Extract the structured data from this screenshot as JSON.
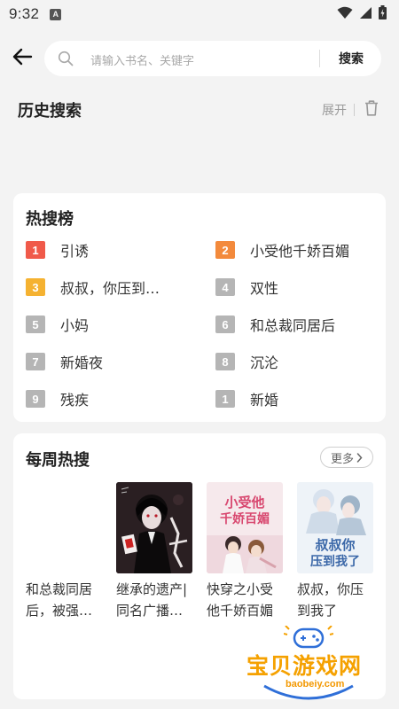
{
  "status_bar": {
    "time": "9:32",
    "notification_badge": "A"
  },
  "search": {
    "placeholder": "请输入书名、关键字",
    "button_label": "搜索"
  },
  "history": {
    "title": "历史搜索",
    "expand_label": "展开"
  },
  "hot_list": {
    "title": "热搜榜",
    "rank_colors": {
      "1": "#f05a4a",
      "2": "#f38a3c",
      "3": "#f5b231",
      "other": "#b5b5b5"
    },
    "items": [
      {
        "rank": "1",
        "title": "引诱"
      },
      {
        "rank": "2",
        "title": "小受他千娇百媚"
      },
      {
        "rank": "3",
        "title": "叔叔，你压到…"
      },
      {
        "rank": "4",
        "title": "双性"
      },
      {
        "rank": "5",
        "title": "小妈"
      },
      {
        "rank": "6",
        "title": "和总裁同居后"
      },
      {
        "rank": "7",
        "title": "新婚夜"
      },
      {
        "rank": "8",
        "title": "沉沦"
      },
      {
        "rank": "9",
        "title": "残疾"
      },
      {
        "rank": "1",
        "title": "新婚"
      }
    ]
  },
  "weekly": {
    "title": "每周热搜",
    "more_label": "更多",
    "books": [
      {
        "title": "和总裁同居后，被强…",
        "cover": "none"
      },
      {
        "title": "继承的遗产|同名广播…",
        "cover": "dark-poster"
      },
      {
        "title": "快穿之小受他千娇百媚",
        "cover": "pink-poster",
        "cover_text": "小受他千娇百媚"
      },
      {
        "title": "叔叔，你压到我了",
        "cover": "blue-poster",
        "cover_text": "叔叔你压到我了"
      }
    ]
  },
  "watermark": {
    "text": "宝贝游戏网",
    "url": "baobeiy.com"
  }
}
